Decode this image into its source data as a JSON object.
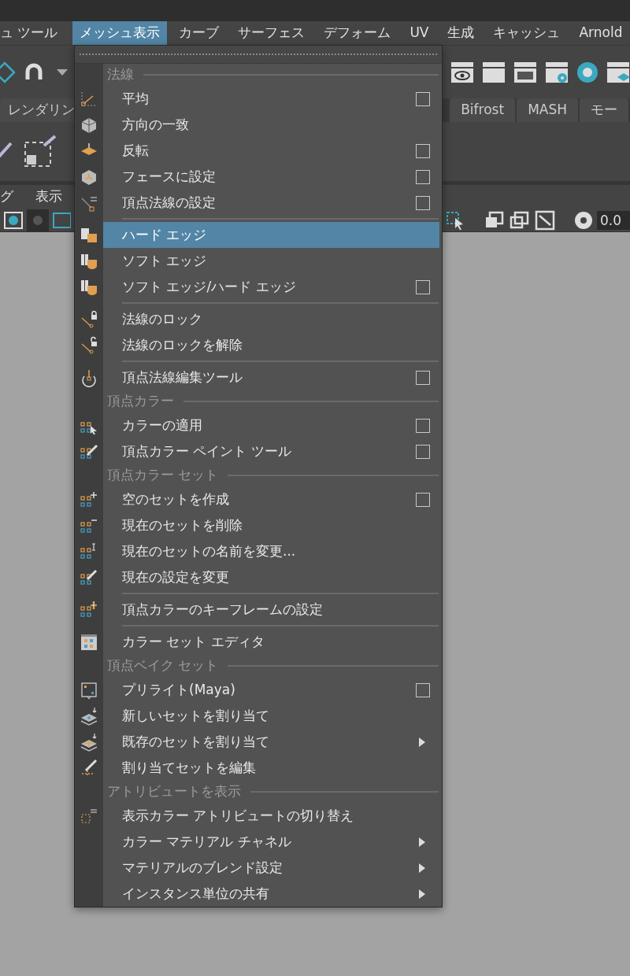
{
  "menubar": [
    {
      "label": "ュ ツール",
      "selected": false
    },
    {
      "label": "メッシュ表示",
      "selected": true
    },
    {
      "label": "カーブ",
      "selected": false
    },
    {
      "label": "サーフェス",
      "selected": false
    },
    {
      "label": "デフォーム",
      "selected": false
    },
    {
      "label": "UV",
      "selected": false
    },
    {
      "label": "生成",
      "selected": false
    },
    {
      "label": "キャッシュ",
      "selected": false
    },
    {
      "label": "Arnold",
      "selected": false
    }
  ],
  "shelf_tabs": [
    {
      "label": "レンダリン"
    },
    {
      "label": "Bifrost"
    },
    {
      "label": "MASH"
    },
    {
      "label": "モー"
    }
  ],
  "panel_menu": [
    {
      "label": "グ"
    },
    {
      "label": "表示"
    }
  ],
  "panel_field": {
    "value": "0.0"
  },
  "menu": {
    "entries": [
      {
        "kind": "header",
        "label": "法線"
      },
      {
        "kind": "item",
        "label": "平均",
        "option_box": true,
        "submenu": false,
        "highlighted": false
      },
      {
        "kind": "item",
        "label": "方向の一致",
        "option_box": false,
        "submenu": false,
        "highlighted": false
      },
      {
        "kind": "item",
        "label": "反転",
        "option_box": true,
        "submenu": false,
        "highlighted": false
      },
      {
        "kind": "item",
        "label": "フェースに設定",
        "option_box": true,
        "submenu": false,
        "highlighted": false
      },
      {
        "kind": "item",
        "label": "頂点法線の設定",
        "option_box": true,
        "submenu": false,
        "highlighted": false
      },
      {
        "kind": "divider"
      },
      {
        "kind": "item",
        "label": "ハード エッジ",
        "option_box": false,
        "submenu": false,
        "highlighted": true
      },
      {
        "kind": "item",
        "label": "ソフト エッジ",
        "option_box": false,
        "submenu": false,
        "highlighted": false
      },
      {
        "kind": "item",
        "label": "ソフト エッジ/ハード エッジ",
        "option_box": true,
        "submenu": false,
        "highlighted": false
      },
      {
        "kind": "divider"
      },
      {
        "kind": "item",
        "label": "法線のロック",
        "option_box": false,
        "submenu": false,
        "highlighted": false
      },
      {
        "kind": "item",
        "label": "法線のロックを解除",
        "option_box": false,
        "submenu": false,
        "highlighted": false
      },
      {
        "kind": "divider"
      },
      {
        "kind": "item",
        "label": "頂点法線編集ツール",
        "option_box": true,
        "submenu": false,
        "highlighted": false
      },
      {
        "kind": "header",
        "label": "頂点カラー"
      },
      {
        "kind": "item",
        "label": "カラーの適用",
        "option_box": true,
        "submenu": false,
        "highlighted": false
      },
      {
        "kind": "item",
        "label": "頂点カラー ペイント ツール",
        "option_box": true,
        "submenu": false,
        "highlighted": false
      },
      {
        "kind": "header",
        "label": "頂点カラー セット"
      },
      {
        "kind": "item",
        "label": "空のセットを作成",
        "option_box": true,
        "submenu": false,
        "highlighted": false
      },
      {
        "kind": "item",
        "label": "現在のセットを削除",
        "option_box": false,
        "submenu": false,
        "highlighted": false
      },
      {
        "kind": "item",
        "label": "現在のセットの名前を変更...",
        "option_box": false,
        "submenu": false,
        "highlighted": false
      },
      {
        "kind": "item",
        "label": "現在の設定を変更",
        "option_box": false,
        "submenu": false,
        "highlighted": false
      },
      {
        "kind": "divider"
      },
      {
        "kind": "item",
        "label": "頂点カラーのキーフレームの設定",
        "option_box": false,
        "submenu": false,
        "highlighted": false
      },
      {
        "kind": "divider"
      },
      {
        "kind": "item",
        "label": "カラー セット エディタ",
        "option_box": false,
        "submenu": false,
        "highlighted": false
      },
      {
        "kind": "header",
        "label": "頂点ベイク セット"
      },
      {
        "kind": "item",
        "label": "プリライト(Maya)",
        "option_box": true,
        "submenu": false,
        "highlighted": false
      },
      {
        "kind": "item",
        "label": "新しいセットを割り当て",
        "option_box": false,
        "submenu": false,
        "highlighted": false
      },
      {
        "kind": "item",
        "label": "既存のセットを割り当て",
        "option_box": false,
        "submenu": true,
        "highlighted": false
      },
      {
        "kind": "item",
        "label": "割り当てセットを編集",
        "option_box": false,
        "submenu": false,
        "highlighted": false
      },
      {
        "kind": "header",
        "label": "アトリビュートを表示"
      },
      {
        "kind": "item",
        "label": "表示カラー アトリビュートの切り替え",
        "option_box": false,
        "submenu": false,
        "highlighted": false
      },
      {
        "kind": "item",
        "label": "カラー マテリアル チャネル",
        "option_box": false,
        "submenu": true,
        "highlighted": false
      },
      {
        "kind": "item",
        "label": "マテリアルのブレンド設定",
        "option_box": false,
        "submenu": true,
        "highlighted": false
      },
      {
        "kind": "item",
        "label": "インスタンス単位の共有",
        "option_box": false,
        "submenu": true,
        "highlighted": false
      }
    ]
  }
}
